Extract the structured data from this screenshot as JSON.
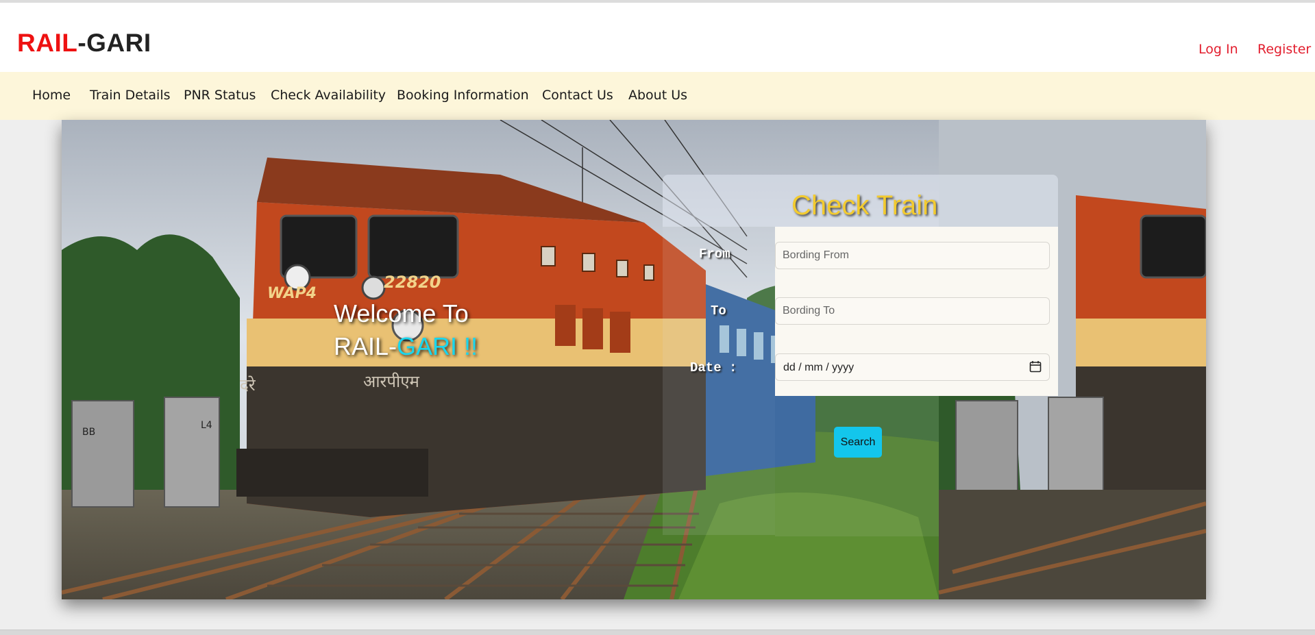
{
  "brand": {
    "part1": "RAIL",
    "part2": "-GARI"
  },
  "auth": {
    "login": "Log In",
    "register": "Register"
  },
  "nav": {
    "home": "Home",
    "train_details": "Train Details",
    "pnr_status": "PNR Status",
    "check_availability": "Check Availability",
    "booking_information": "Booking Information",
    "contact_us": "Contact Us",
    "about_us": "About Us"
  },
  "hero": {
    "welcome_line1": "Welcome To",
    "welcome_prefix": "RAIL-",
    "welcome_highlight": "GARI !!",
    "locomotive_number": "22820",
    "locomotive_class": "WAP4",
    "locomotive_devanagari_left": "दरे",
    "locomotive_devanagari_right": "आरपीएम",
    "hut_left_label": "BB",
    "hut_right_label": "L4"
  },
  "check_train": {
    "title": "Check Train",
    "from_label": "From",
    "to_label": "To",
    "date_label": "Date :",
    "from_placeholder": "Bording From",
    "to_placeholder": "Bording To",
    "date_placeholder": "dd / mm / yyyy",
    "search_label": "Search"
  },
  "colors": {
    "brand_red": "#ee1111",
    "nav_background": "#fdf6da",
    "accent_cyan": "#13c6ec",
    "title_yellow": "#f3cb2f",
    "auth_link": "#e21d2d"
  },
  "icons": {
    "date_picker": "calendar-icon"
  }
}
